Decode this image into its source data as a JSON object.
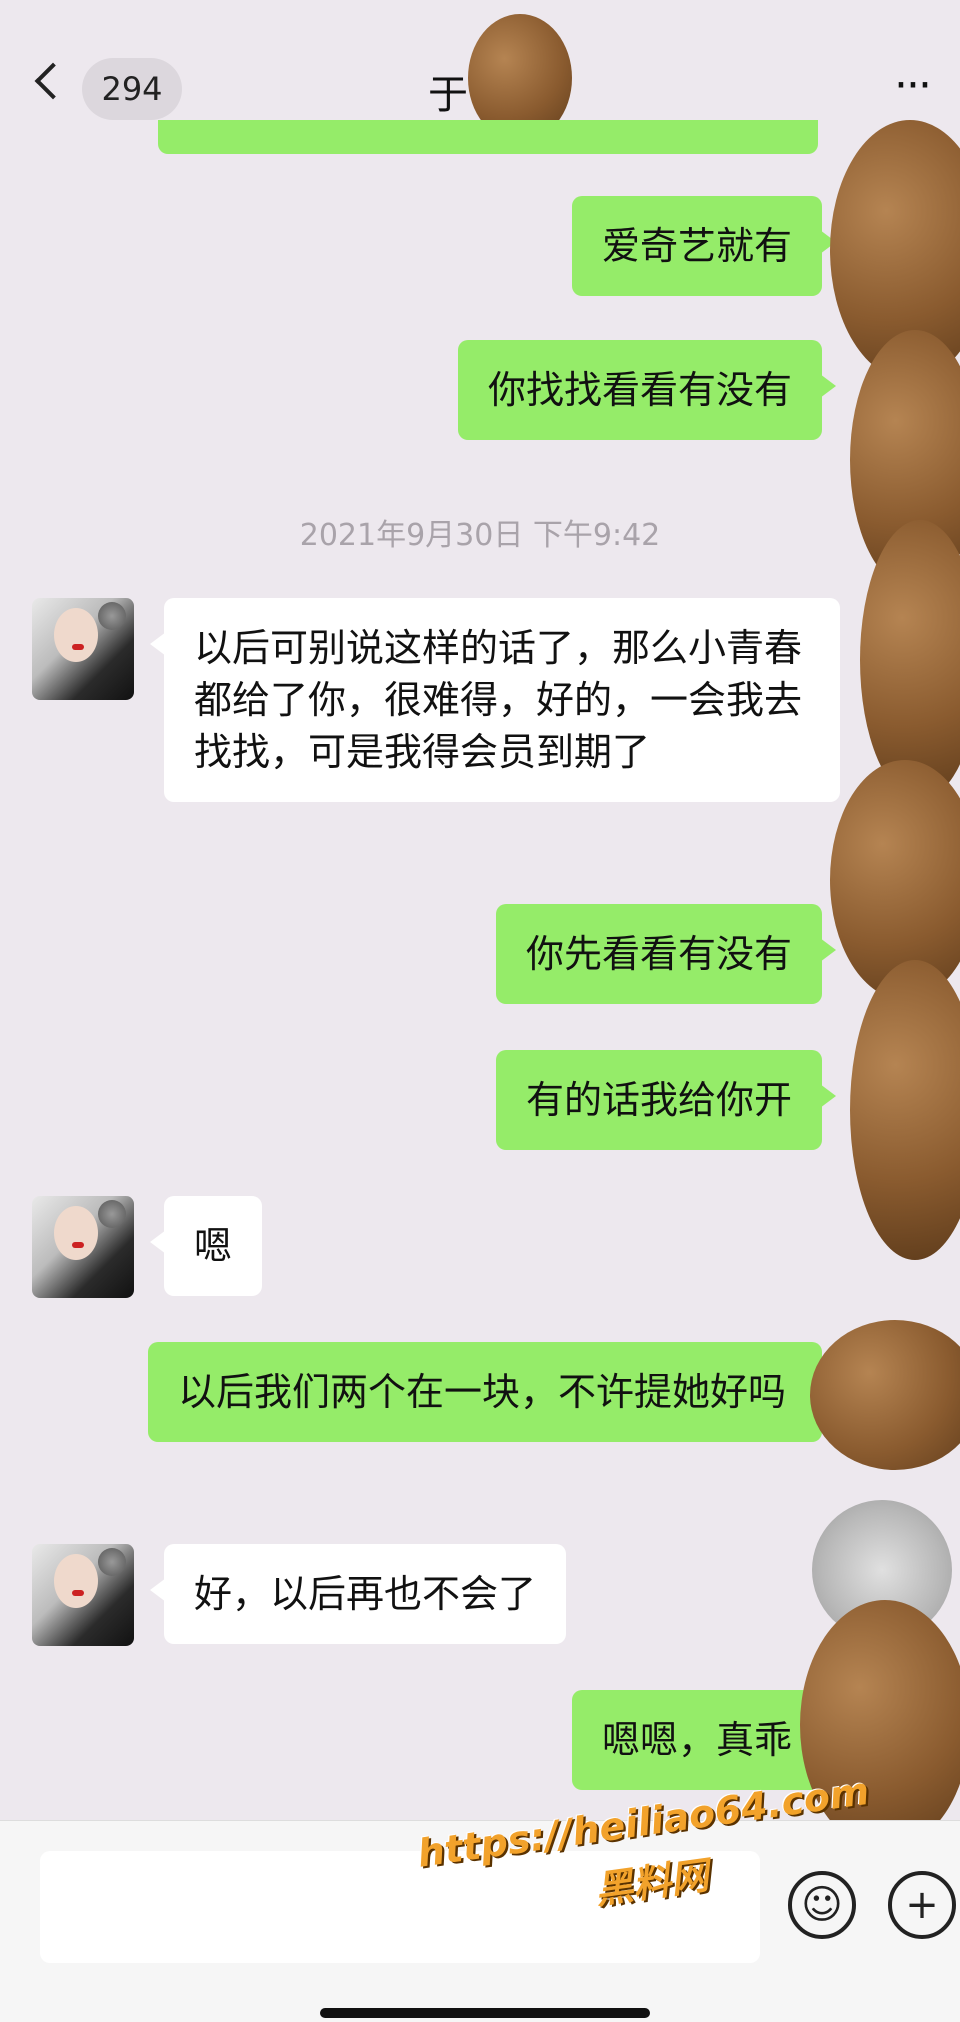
{
  "header": {
    "back_label": "294",
    "contact_name": "于"
  },
  "messages": [
    {
      "dir": "out",
      "text": "爱奇艺就有"
    },
    {
      "dir": "out",
      "text": "你找找看看有没有"
    },
    {
      "dir": "time",
      "text": "2021年9月30日 下午9:42"
    },
    {
      "dir": "in",
      "text": "以后可别说这样的话了，那么小青春都给了你，很难得，好的，一会我去找找，可是我得会员到期了"
    },
    {
      "dir": "out",
      "text": "你先看看有没有"
    },
    {
      "dir": "out",
      "text": "有的话我给你开"
    },
    {
      "dir": "in",
      "text": "嗯"
    },
    {
      "dir": "out",
      "text": "以后我们两个在一块，不许提她好吗"
    },
    {
      "dir": "in",
      "text": "好，以后再也不会了"
    },
    {
      "dir": "out",
      "text": "嗯嗯，真乖"
    }
  ],
  "watermark": {
    "url": "https://heiliao64.com",
    "site_name": "黑料网"
  },
  "icons": {
    "back": "chevron-left-icon",
    "more": "more-icon",
    "emoji": "emoji-icon",
    "plus": "plus-icon"
  },
  "colors": {
    "outgoing_bubble": "#95ec69",
    "incoming_bubble": "#ffffff",
    "background": "#ede8ee"
  }
}
